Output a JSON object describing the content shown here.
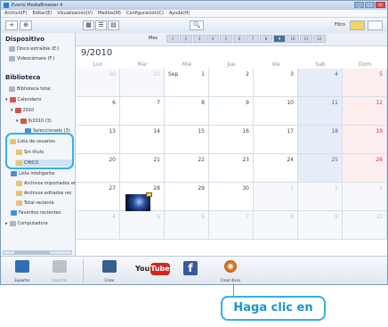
{
  "window": {
    "title": "Everio MediaBrowser 4",
    "controls": [
      "_",
      "□",
      "×"
    ]
  },
  "menu": [
    "Archivo(F)",
    "Editar(E)",
    "Visualización(V)",
    "Medios(M)",
    "Configuración(C)",
    "Ayuda(H)"
  ],
  "toolbar": {
    "plus_label": "+",
    "add_label": "⊕",
    "view_icons": [
      "▦",
      "☰",
      "▤"
    ],
    "search_label": "🔍",
    "filter_label": "Filtro"
  },
  "sidebar": {
    "device_heading": "Dispositivo",
    "devices": [
      "Disco extraíble (E:)",
      "Videocámara (F:)"
    ],
    "library_heading": "Biblioteca",
    "library_items": [
      "Biblioteca total",
      "Calendario",
      "2010",
      "9/2010 (3)",
      "Seleccionado (3)",
      "Lista de usuarios",
      "Sin título",
      "CHICO",
      "Lista inteligente",
      "Archivos importados en",
      "Archivos editados rec",
      "Total reciente",
      "Favoritos recientes",
      "Computadora"
    ]
  },
  "calendar": {
    "mes_label": "Mes",
    "months": [
      "1",
      "2",
      "3",
      "4",
      "5",
      "6",
      "7",
      "8",
      "9",
      "10",
      "11",
      "12"
    ],
    "selected_month": "9",
    "title": "9/2010",
    "day_labels": [
      "Lun",
      "Mar",
      "Mié",
      "Jue",
      "Vie",
      "Sab",
      "Dom"
    ],
    "weeks": [
      [
        {
          "d": "30",
          "o": true
        },
        {
          "d": "31",
          "o": true
        },
        {
          "d": "1",
          "label": "Sep"
        },
        {
          "d": "2"
        },
        {
          "d": "3"
        },
        {
          "d": "4"
        },
        {
          "d": "5"
        }
      ],
      [
        {
          "d": "6"
        },
        {
          "d": "7"
        },
        {
          "d": "8"
        },
        {
          "d": "9"
        },
        {
          "d": "10"
        },
        {
          "d": "11"
        },
        {
          "d": "12"
        }
      ],
      [
        {
          "d": "13"
        },
        {
          "d": "14"
        },
        {
          "d": "15"
        },
        {
          "d": "16"
        },
        {
          "d": "17"
        },
        {
          "d": "18"
        },
        {
          "d": "19"
        }
      ],
      [
        {
          "d": "20"
        },
        {
          "d": "21"
        },
        {
          "d": "22"
        },
        {
          "d": "23"
        },
        {
          "d": "24"
        },
        {
          "d": "25"
        },
        {
          "d": "26"
        }
      ],
      [
        {
          "d": "27"
        },
        {
          "d": "28",
          "thumb": true
        },
        {
          "d": "29"
        },
        {
          "d": "30"
        },
        {
          "d": "1",
          "o": true
        },
        {
          "d": "2",
          "o": true
        },
        {
          "d": "3",
          "o": true
        }
      ],
      [
        {
          "d": "4",
          "o": true
        },
        {
          "d": "5",
          "o": true
        },
        {
          "d": "6",
          "o": true
        },
        {
          "d": "7",
          "o": true
        },
        {
          "d": "8",
          "o": true
        },
        {
          "d": "9",
          "o": true
        },
        {
          "d": "10",
          "o": true
        }
      ]
    ]
  },
  "bottom": {
    "buttons": [
      "Exportar",
      "Importar",
      "Crear",
      "YouTube",
      "Facebook",
      "Crear disco"
    ],
    "you_text": "You",
    "tube_text": "Tube",
    "fb_text": "f"
  },
  "callout": {
    "text": "Haga clic en"
  },
  "colors": {
    "accent": "#34b0e8",
    "callout_text": "#1795d4",
    "youtube": "#d6261b",
    "facebook": "#3b5998"
  }
}
